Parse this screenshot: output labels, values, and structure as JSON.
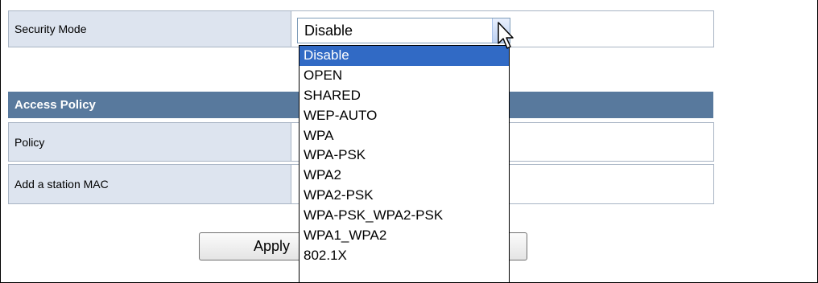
{
  "security_mode": {
    "label": "Security Mode",
    "selected": "Disable",
    "options": [
      "Disable",
      "OPEN",
      "SHARED",
      "WEP-AUTO",
      "WPA",
      "WPA-PSK",
      "WPA2",
      "WPA2-PSK",
      "WPA-PSK_WPA2-PSK",
      "WPA1_WPA2",
      "802.1X"
    ]
  },
  "access_policy": {
    "header": "Access Policy",
    "policy_label": "Policy",
    "station_mac_label": "Add a station MAC"
  },
  "buttons": {
    "apply_label": "Apply"
  },
  "colors": {
    "header_bg": "#58799d",
    "label_bg": "#dde4ef",
    "selected_option_bg": "#316ac5"
  }
}
